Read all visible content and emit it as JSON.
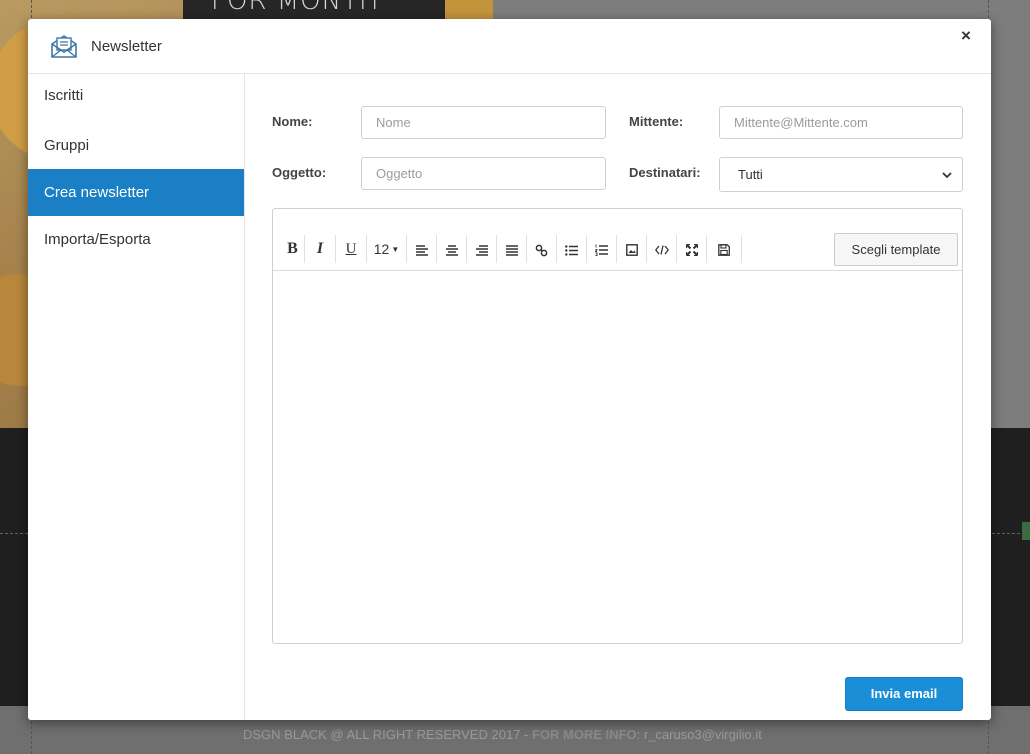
{
  "background": {
    "banner_text": "FOR MONTH",
    "footer_text": "DSGN BLACK @ ALL RIGHT RESERVED 2017 - ",
    "footer_bold": "FOR MORE INFO",
    "footer_email": ": r_caruso3@virgilio.it"
  },
  "modal": {
    "title": "Newsletter",
    "icon": "envelope-icon",
    "close_label": "×"
  },
  "sidebar": {
    "items": [
      {
        "label": "Iscritti",
        "active": false
      },
      {
        "label": "Gruppi",
        "active": false
      },
      {
        "label": "Crea newsletter",
        "active": true
      },
      {
        "label": "Importa/Esporta",
        "active": false
      }
    ]
  },
  "form": {
    "nome_label": "Nome:",
    "nome_placeholder": "Nome",
    "mittente_label": "Mittente:",
    "mittente_placeholder": "Mittente@Mittente.com",
    "oggetto_label": "Oggetto:",
    "oggetto_placeholder": "Oggetto",
    "destinatari_label": "Destinatari:",
    "destinatari_value": "Tutti"
  },
  "toolbar": {
    "bold": "B",
    "italic": "I",
    "underline": "U",
    "font_size": "12",
    "template_button": "Scegli template"
  },
  "actions": {
    "send_button": "Invia email"
  },
  "colors": {
    "accent": "#1a7fc4",
    "send_button": "#1a8fd8"
  }
}
